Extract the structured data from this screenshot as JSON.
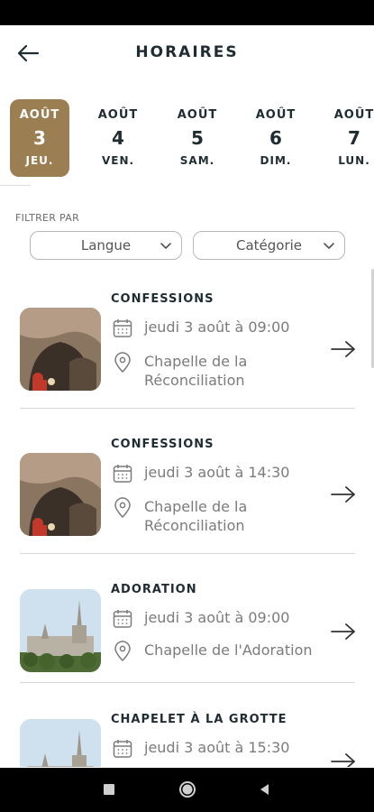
{
  "header": {
    "title": "HORAIRES",
    "back_icon": "arrow-left-icon"
  },
  "dates": [
    {
      "month": "AOÛT",
      "day": "3",
      "weekday": "JEU.",
      "selected": true
    },
    {
      "month": "AOÛT",
      "day": "4",
      "weekday": "VEN.",
      "selected": false
    },
    {
      "month": "AOÛT",
      "day": "5",
      "weekday": "SAM.",
      "selected": false
    },
    {
      "month": "AOÛT",
      "day": "6",
      "weekday": "DIM.",
      "selected": false
    },
    {
      "month": "AOÛT",
      "day": "7",
      "weekday": "LUN.",
      "selected": false
    }
  ],
  "filters": {
    "label": "FILTRER PAR",
    "language": "Langue",
    "category": "Catégorie"
  },
  "events": [
    {
      "title": "CONFESSIONS",
      "datetime": "jeudi 3 août à 09:00",
      "place": "Chapelle de la Réconciliation",
      "image": "grotto"
    },
    {
      "title": "CONFESSIONS",
      "datetime": "jeudi 3 août à 14:30",
      "place": "Chapelle de la Réconciliation",
      "image": "grotto"
    },
    {
      "title": "ADORATION",
      "datetime": "jeudi 3 août à 09:00",
      "place": "Chapelle de l'Adoration",
      "image": "basilica"
    },
    {
      "title": "CHAPELET À LA GROTTE",
      "datetime": "jeudi 3 août à 15:30",
      "place": "",
      "image": "basilica"
    }
  ],
  "colors": {
    "accent": "#9b7f53",
    "text": "#1f2d33",
    "muted": "#7b7b7b"
  }
}
